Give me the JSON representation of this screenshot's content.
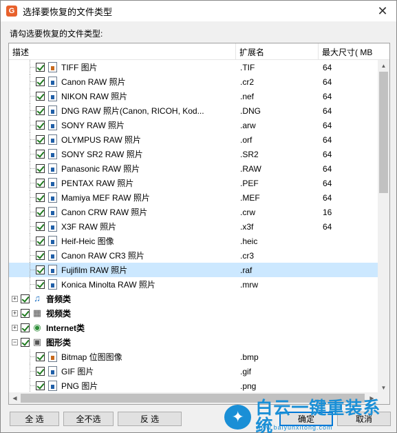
{
  "window": {
    "title": "选择要恢复的文件类型",
    "app_icon_letter": "G",
    "close_glyph": "✕"
  },
  "instruction": "请勾选要恢复的文件类型:",
  "columns": [
    "描述",
    "扩展名",
    "最大尺寸( MB"
  ],
  "rows": [
    {
      "label": "TIFF 图片",
      "ext": ".TIF",
      "size": "64",
      "icon": "image-file-icon"
    },
    {
      "label": "Canon RAW 照片",
      "ext": ".cr2",
      "size": "64",
      "icon": "file-icon"
    },
    {
      "label": "NIKON RAW 照片",
      "ext": ".nef",
      "size": "64",
      "icon": "file-icon"
    },
    {
      "label": "DNG RAW 照片(Canon, RICOH, Kod...",
      "ext": ".DNG",
      "size": "64",
      "icon": "file-icon"
    },
    {
      "label": "SONY RAW 照片",
      "ext": ".arw",
      "size": "64",
      "icon": "file-icon"
    },
    {
      "label": "OLYMPUS RAW 照片",
      "ext": ".orf",
      "size": "64",
      "icon": "file-icon"
    },
    {
      "label": "SONY SR2 RAW 照片",
      "ext": ".SR2",
      "size": "64",
      "icon": "file-icon"
    },
    {
      "label": "Panasonic RAW 照片",
      "ext": ".RAW",
      "size": "64",
      "icon": "file-icon"
    },
    {
      "label": "PENTAX RAW 照片",
      "ext": ".PEF",
      "size": "64",
      "icon": "file-icon"
    },
    {
      "label": "Mamiya MEF RAW 照片",
      "ext": ".MEF",
      "size": "64",
      "icon": "file-icon"
    },
    {
      "label": "Canon CRW RAW 照片",
      "ext": ".crw",
      "size": "16",
      "icon": "file-icon"
    },
    {
      "label": "X3F RAW 照片",
      "ext": ".x3f",
      "size": "64",
      "icon": "file-icon"
    },
    {
      "label": "Heif-Heic 图像",
      "ext": ".heic",
      "size": "",
      "icon": "file-icon"
    },
    {
      "label": "Canon RAW CR3 照片",
      "ext": ".cr3",
      "size": "",
      "icon": "file-icon"
    },
    {
      "label": "Fujifilm RAW 照片",
      "ext": ".raf",
      "size": "",
      "icon": "file-icon",
      "selected": true
    },
    {
      "label": "Konica Minolta RAW 照片",
      "ext": ".mrw",
      "size": "",
      "icon": "file-icon"
    }
  ],
  "categories": [
    {
      "label": "音频类",
      "expander": "+",
      "icon": "music-note-icon",
      "glyph": "♫"
    },
    {
      "label": "视频类",
      "expander": "+",
      "icon": "film-icon",
      "glyph": "▦"
    },
    {
      "label": "Internet类",
      "expander": "+",
      "icon": "globe-icon",
      "glyph": "◉"
    },
    {
      "label": "图形类",
      "expander": "−",
      "icon": "picture-icon",
      "glyph": "▣"
    }
  ],
  "graphics_rows": [
    {
      "label": "Bitmap 位图图像",
      "ext": ".bmp",
      "size": "",
      "icon": "paint-palette-icon"
    },
    {
      "label": "GIF 图片",
      "ext": ".gif",
      "size": "",
      "icon": "file-icon"
    },
    {
      "label": "PNG 图片",
      "ext": ".png",
      "size": "",
      "icon": "file-icon"
    }
  ],
  "buttons": {
    "select_all": "全 选",
    "select_none": "全不选",
    "invert": "反 选",
    "ok": "确定",
    "cancel": "取消"
  },
  "watermark": {
    "text": "白云一键重装系统",
    "url": "www.baiyunxitong.com"
  }
}
